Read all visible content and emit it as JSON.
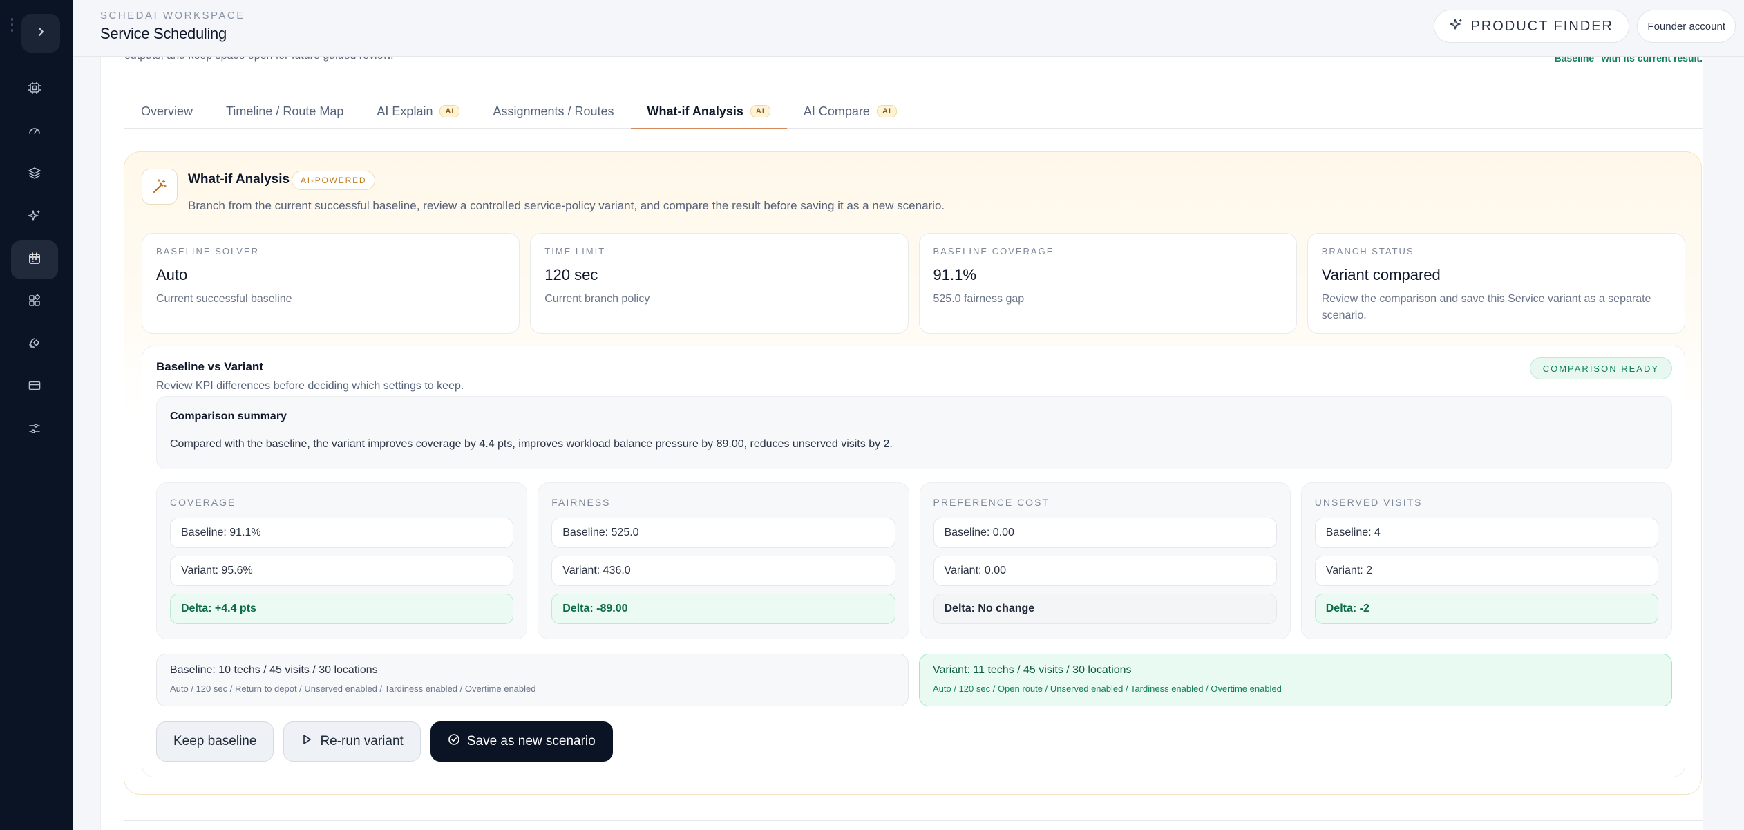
{
  "header": {
    "workspace_label": "SCHEDAI WORKSPACE",
    "page_title": "Service Scheduling",
    "product_finder_label": "PRODUCT FINDER",
    "account_label": "Founder account"
  },
  "sidebar": {
    "toggle_icon": "chevron-right-icon",
    "items": [
      {
        "icon": "chip-icon",
        "active": false
      },
      {
        "icon": "gauge-icon",
        "active": false
      },
      {
        "icon": "layers-icon",
        "active": false
      },
      {
        "icon": "sparkles-icon",
        "active": false
      },
      {
        "icon": "calendar-icon",
        "active": true
      },
      {
        "icon": "widgets-icon",
        "active": false
      },
      {
        "icon": "brain-icon",
        "active": false
      },
      {
        "icon": "card-icon",
        "active": false
      },
      {
        "icon": "sliders-icon",
        "active": false
      }
    ]
  },
  "intro": {
    "cut_text": "outputs, and keep space open for future guided review.",
    "note_text": "Baseline\" with its current result."
  },
  "tabs": [
    {
      "label": "Overview",
      "ai": false,
      "active": false
    },
    {
      "label": "Timeline / Route Map",
      "ai": false,
      "active": false
    },
    {
      "label": "AI Explain",
      "ai": true,
      "active": false
    },
    {
      "label": "Assignments / Routes",
      "ai": false,
      "active": false
    },
    {
      "label": "What-if Analysis",
      "ai": true,
      "active": true
    },
    {
      "label": "AI Compare",
      "ai": true,
      "active": false
    }
  ],
  "ai_chip": "AI",
  "panel": {
    "title": "What-if Analysis",
    "badge": "AI-POWERED",
    "description": "Branch from the current successful baseline, review a controlled service-policy variant, and compare the result before saving it as a new scenario."
  },
  "stats": [
    {
      "label": "BASELINE SOLVER",
      "value": "Auto",
      "sub": "Current successful baseline"
    },
    {
      "label": "TIME LIMIT",
      "value": "120 sec",
      "sub": "Current branch policy"
    },
    {
      "label": "BASELINE COVERAGE",
      "value": "91.1%",
      "sub": "525.0 fairness gap"
    },
    {
      "label": "BRANCH STATUS",
      "value": "Variant compared",
      "sub": "Review the comparison and save this Service variant as a separate scenario."
    }
  ],
  "comparison": {
    "title": "Baseline vs Variant",
    "description": "Review KPI differences before deciding which settings to keep.",
    "badge": "COMPARISON READY",
    "summary_title": "Comparison summary",
    "summary_text": "Compared with the baseline, the variant improves coverage by 4.4 pts, improves workload balance pressure by 89.00, reduces unserved visits by 2."
  },
  "metrics": [
    {
      "label": "COVERAGE",
      "baseline": "Baseline: 91.1%",
      "variant": "Variant: 95.6%",
      "delta": "Delta: +4.4 pts",
      "tone": "good"
    },
    {
      "label": "FAIRNESS",
      "baseline": "Baseline: 525.0",
      "variant": "Variant: 436.0",
      "delta": "Delta: -89.00",
      "tone": "good"
    },
    {
      "label": "PREFERENCE COST",
      "baseline": "Baseline: 0.00",
      "variant": "Variant: 0.00",
      "delta": "Delta: No change",
      "tone": "neutral"
    },
    {
      "label": "UNSERVED VISITS",
      "baseline": "Baseline: 4",
      "variant": "Variant: 2",
      "delta": "Delta: -2",
      "tone": "good"
    }
  ],
  "summary_cards": {
    "baseline": {
      "title": "Baseline: 10 techs / 45 visits / 30 locations",
      "sub": "Auto / 120 sec / Return to depot / Unserved enabled / Tardiness enabled / Overtime enabled"
    },
    "variant": {
      "title": "Variant: 11 techs / 45 visits / 30 locations",
      "sub": "Auto / 120 sec / Open route / Unserved enabled / Tardiness enabled / Overtime enabled"
    }
  },
  "actions": {
    "keep_baseline": "Keep baseline",
    "rerun_variant": "Re-run variant",
    "save_scenario": "Save as new scenario"
  }
}
